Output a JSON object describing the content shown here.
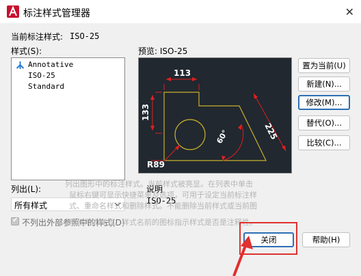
{
  "window": {
    "title": "标注样式管理器"
  },
  "current_style": {
    "label": "当前标注样式:",
    "value": "ISO-25"
  },
  "styles": {
    "label": "样式(S):",
    "items": [
      "Annotative",
      "ISO-25",
      "Standard"
    ]
  },
  "preview": {
    "label": "预览: ISO-25",
    "dims": {
      "top": "113",
      "left": "133",
      "angle": "60°",
      "diag": "225",
      "radius": "R89"
    }
  },
  "buttons": {
    "set_current": "置为当前(U)",
    "new": "新建(N)...",
    "modify": "修改(M)...",
    "override": "替代(O)...",
    "compare": "比较(C)...",
    "close": "关闭",
    "help": "帮助(H)"
  },
  "list_filter": {
    "label": "列出(L):",
    "value": "所有样式"
  },
  "exclude_xref": {
    "label": "不列出外部参照中的样式(D)",
    "checked": true
  },
  "description": {
    "label": "说明",
    "value": "ISO-25"
  },
  "description_overlay": [
    "列出图形中的标注样式。当前样式被亮显。在列表中单击",
    "鼠标右键可显示快捷菜单及选项，可用于设定当前标注样",
    "式、重命名样式和删除样式。不能删除当前样式或当前图",
    "形使用的样式。样式名前的图标指示样式是否是注释性。"
  ],
  "colors": {
    "preview_bg": "#212830",
    "dim_red": "#e02020",
    "geom_yellow": "#c8b12a",
    "accent": "#e0302f"
  }
}
